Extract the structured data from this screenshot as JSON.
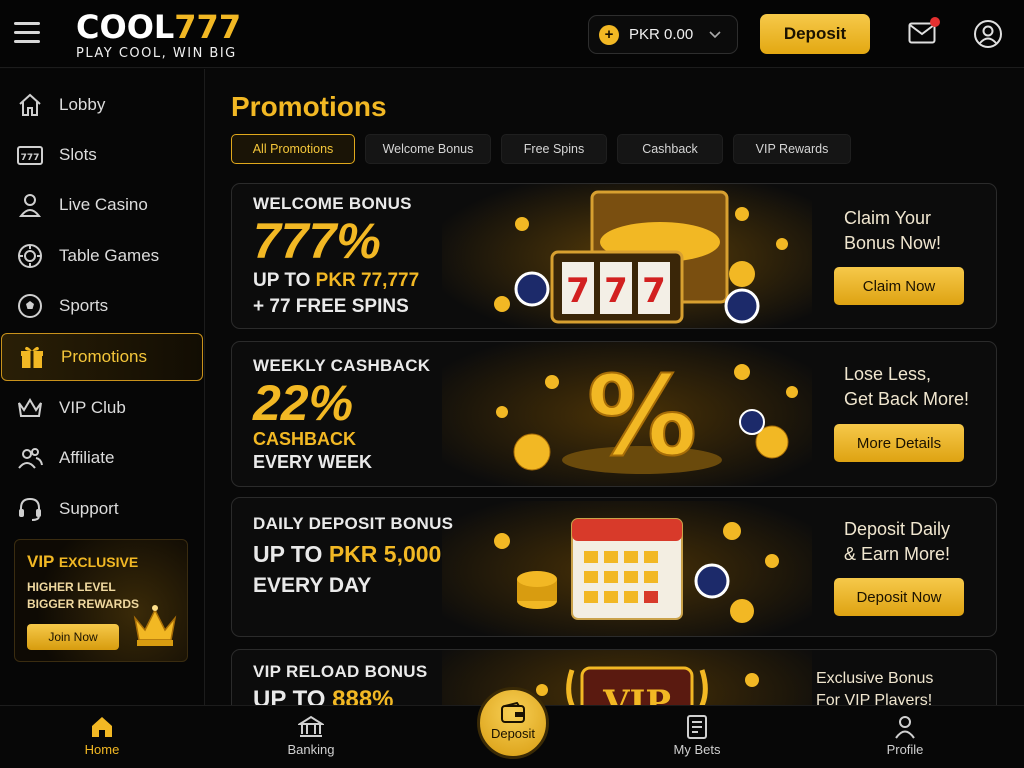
{
  "header": {
    "logo_main": "COOL",
    "logo_num": "777",
    "tagline": "PLAY COOL, WIN BIG",
    "balance": "PKR 0.00",
    "deposit_label": "Deposit"
  },
  "sidebar": {
    "items": [
      {
        "label": "Lobby",
        "icon": "home-icon"
      },
      {
        "label": "Slots",
        "icon": "slot-777-icon"
      },
      {
        "label": "Live Casino",
        "icon": "dealer-icon"
      },
      {
        "label": "Table Games",
        "icon": "chip-icon"
      },
      {
        "label": "Sports",
        "icon": "soccer-ball-icon"
      },
      {
        "label": "Promotions",
        "icon": "gift-icon",
        "active": true
      },
      {
        "label": "VIP Club",
        "icon": "crown-icon"
      },
      {
        "label": "Affiliate",
        "icon": "users-icon"
      },
      {
        "label": "Support",
        "icon": "headset-icon"
      }
    ],
    "vip_card": {
      "title": "VIP",
      "title_small": "EXCLUSIVE",
      "line1": "HIGHER LEVEL",
      "line2": "BIGGER REWARDS",
      "button": "Join Now"
    }
  },
  "main": {
    "title": "Promotions",
    "tabs": [
      "All Promotions",
      "Welcome Bonus",
      "Free Spins",
      "Cashback",
      "VIP Rewards"
    ],
    "promos": [
      {
        "heading": "WELCOME BONUS",
        "big": "777%",
        "line1_pre": "UP TO ",
        "line1_hl": "PKR 77,777",
        "line2": "+ 77 FREE SPINS",
        "cta_line1": "Claim Your",
        "cta_line2": "Bonus Now!",
        "button": "Claim Now"
      },
      {
        "heading": "WEEKLY CASHBACK",
        "big": "22%",
        "line1_hl": "CASHBACK",
        "line2": "EVERY WEEK",
        "cta_line1": "Lose Less,",
        "cta_line2": "Get Back More!",
        "button": "More Details"
      },
      {
        "heading": "DAILY DEPOSIT BONUS",
        "line1_pre": "UP TO ",
        "line1_hl": "PKR 5,000",
        "line2": "EVERY DAY",
        "cta_line1": "Deposit Daily",
        "cta_line2": "& Earn More!",
        "button": "Deposit Now"
      },
      {
        "heading": "VIP RELOAD BONUS",
        "line1_pre": "UP TO ",
        "line1_hl": "888%",
        "cta_line1": "Exclusive Bonus",
        "cta_line2": "For VIP Players!"
      }
    ]
  },
  "bottom_nav": {
    "home": "Home",
    "banking": "Banking",
    "deposit": "Deposit",
    "my_bets": "My Bets",
    "profile": "Profile"
  },
  "colors": {
    "accent": "#f2b824",
    "background": "#080808",
    "notification": "#e53030"
  }
}
